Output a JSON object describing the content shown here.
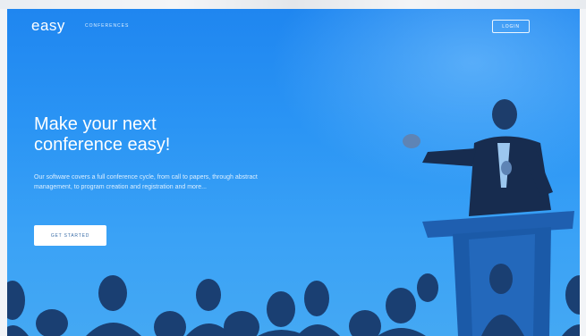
{
  "nav": {
    "logo": "easy",
    "link_conferences": "CONFERENCES",
    "login_label": "LOGIN"
  },
  "hero": {
    "headline_line1": "Make your next",
    "headline_line2": "conference easy!",
    "description": "Our software covers a full conference cycle, from call to papers, through abstract management, to program creation and registration and more...",
    "cta_label": "GET STARTED"
  },
  "colors": {
    "hero_blue": "#2a94f4",
    "button_text": "#3b6ea8",
    "white": "#ffffff"
  }
}
